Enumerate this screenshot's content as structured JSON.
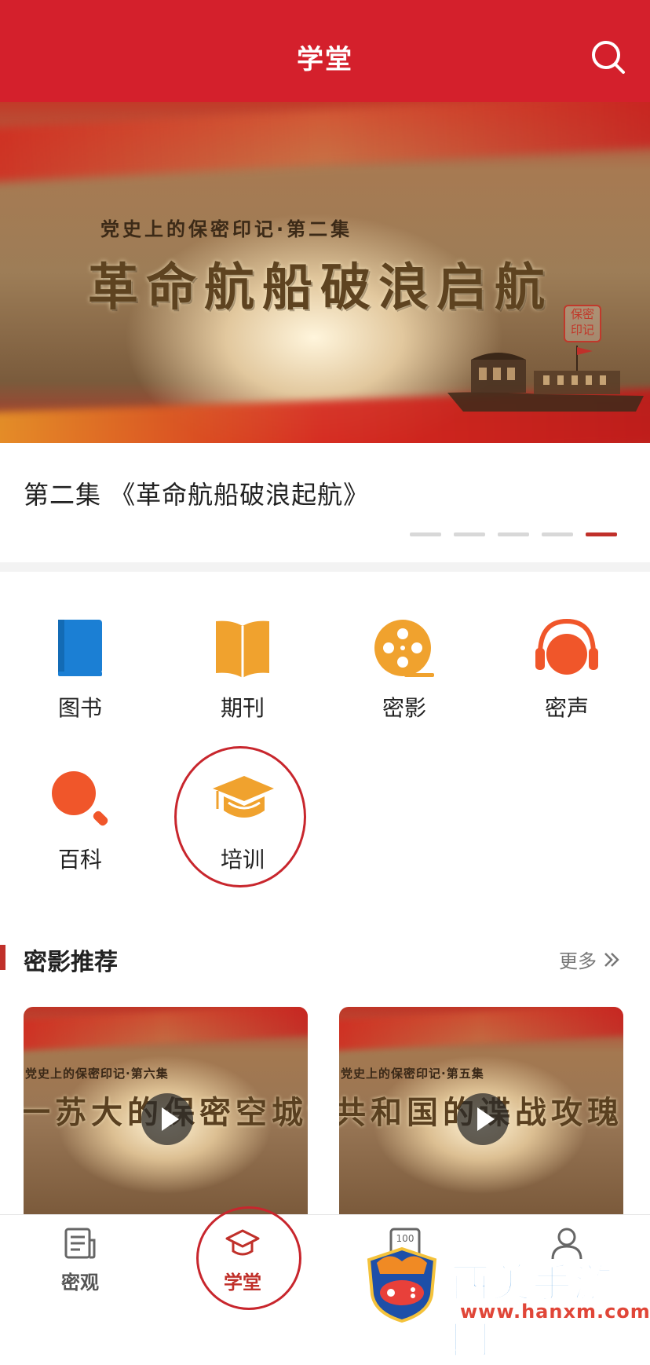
{
  "header": {
    "title": "学堂",
    "search_icon": "search-icon"
  },
  "banner": {
    "subtitle": "党史上的保密印记·第二集",
    "title": "革命航船破浪启航",
    "seal": "保密印记",
    "caption": "第二集 《革命航船破浪起航》",
    "page_count": 5,
    "active_page": 5
  },
  "categories": [
    {
      "label": "图书",
      "icon": "book-icon",
      "color": "#1b7fd4"
    },
    {
      "label": "期刊",
      "icon": "magazine-icon",
      "color": "#f0a22e"
    },
    {
      "label": "密影",
      "icon": "film-reel-icon",
      "color": "#f0a22e"
    },
    {
      "label": "密声",
      "icon": "headphones-icon",
      "color": "#f0562a"
    },
    {
      "label": "百科",
      "icon": "magnifier-icon",
      "color": "#f0562a"
    },
    {
      "label": "培训",
      "icon": "graduation-cap-icon",
      "color": "#f0a22e"
    }
  ],
  "section": {
    "title": "密影推荐",
    "more": "更多"
  },
  "videos": [
    {
      "subtitle": "党史上的保密印记·第六集",
      "title": "一苏大的保密空城计"
    },
    {
      "subtitle": "党史上的保密印记·第五集",
      "title": "共和国的谍战攻瑰"
    }
  ],
  "tabbar": [
    {
      "label": "密观",
      "icon": "newspaper-icon"
    },
    {
      "label": "学堂",
      "icon": "graduation-cap-icon",
      "active": true
    },
    {
      "label": "",
      "icon": "score-100-icon"
    },
    {
      "label": "",
      "icon": "user-icon"
    }
  ],
  "watermark": {
    "text": "西美手游网",
    "url": "www.hanxm.com"
  },
  "colors": {
    "brand_red": "#d4202c",
    "accent_orange": "#f0a22e",
    "accent_blue": "#1b7fd4"
  }
}
